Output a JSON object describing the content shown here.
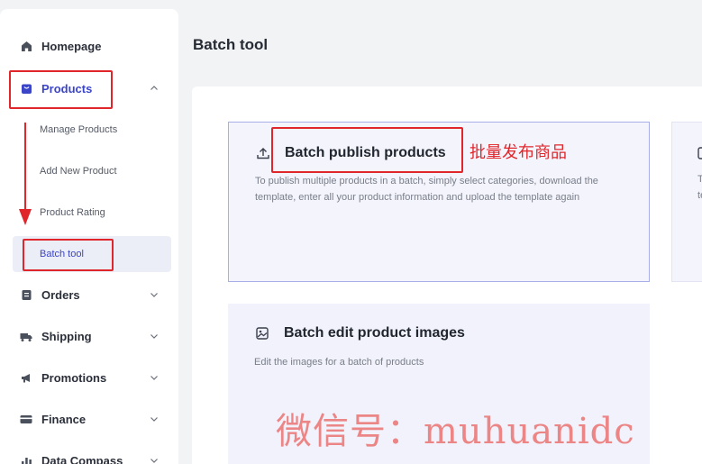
{
  "sidebar": {
    "items": [
      {
        "label": "Homepage"
      },
      {
        "label": "Products"
      },
      {
        "label": "Orders"
      },
      {
        "label": "Shipping"
      },
      {
        "label": "Promotions"
      },
      {
        "label": "Finance"
      },
      {
        "label": "Data Compass"
      }
    ],
    "product_subitems": [
      {
        "label": "Manage Products"
      },
      {
        "label": "Add New Product"
      },
      {
        "label": "Product Rating"
      },
      {
        "label": "Batch tool"
      }
    ]
  },
  "main": {
    "title": "Batch tool",
    "cards": [
      {
        "title": "Batch publish products",
        "description": "To publish multiple products in a batch, simply select categories, download the template, enter all your product information and upload the template again"
      },
      {
        "title": "Batch edit product images",
        "description": "Edit the images for a batch of products"
      }
    ],
    "partial_card_peek": [
      "T",
      "te"
    ]
  },
  "annotations": {
    "chinese_label": "批量发布商品",
    "watermark": "微信号：muhuanidc"
  },
  "colors": {
    "accent": "#3b45c7",
    "annotation_red": "#e0262b",
    "card_bg": "#f1f2fb",
    "card_border": "#a9aee8"
  }
}
